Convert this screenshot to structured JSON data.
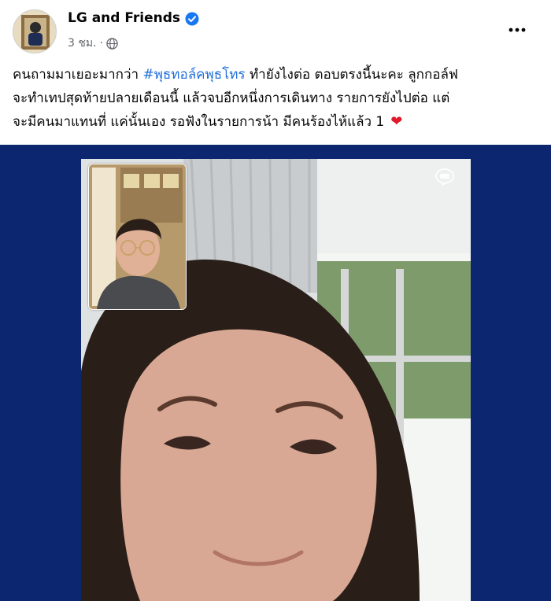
{
  "post": {
    "author": "LG and Friends",
    "time": "3 ชม.",
    "separator": "·",
    "text_lines": {
      "l1_a": "คนถามมาเยอะมากว่า ",
      "l1_hashtag": "#พุธทอล์คพุธโทร",
      "l1_b": " ทำยังไงต่อ ตอบตรงนี้นะคะ ลูกกอล์ฟ",
      "l2": "จะทำเทปสุดท้ายปลายเดือนนี้ แล้วจบอีกหนึ่งการเดินทาง รายการยังไปต่อ แต่",
      "l3": "จะมีคนมาแทนที่ แค่นั้นเอง รอฟังในรายการน้า มีคนร้องไห้แล้ว 1"
    },
    "heart_glyph": "❤"
  },
  "icons": {
    "verified": "verified-badge-icon",
    "audience": "globe-icon",
    "more": "more-options-icon",
    "app_logo": "line-app-icon"
  },
  "colors": {
    "hashtag": "#216fdb",
    "media_background": "#0d2670",
    "verified": "#1877f2",
    "heart": "#e0192b"
  }
}
